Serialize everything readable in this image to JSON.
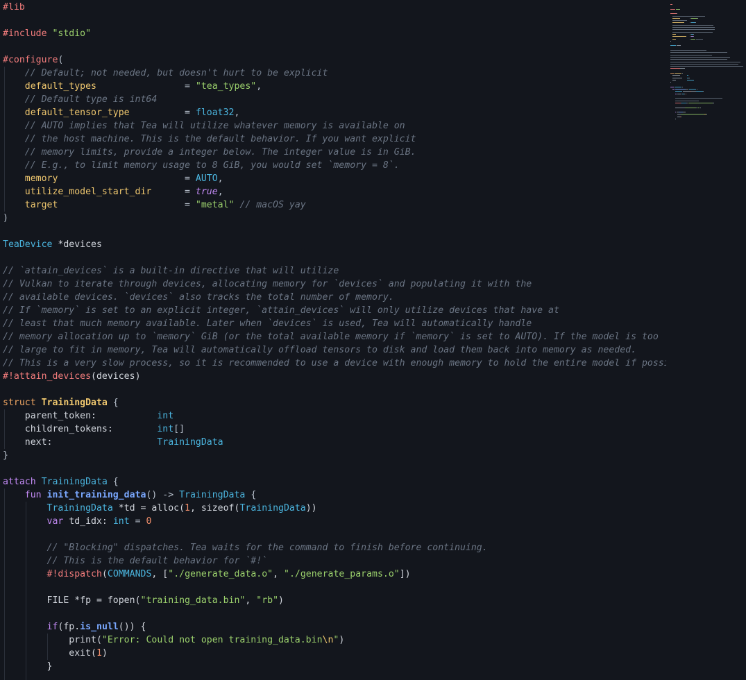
{
  "editor": {
    "language": "tea",
    "lines": [
      [
        [
          "#lib",
          "dir"
        ]
      ],
      [],
      [
        [
          "#include ",
          "dir"
        ],
        [
          "\"stdio\"",
          "str"
        ]
      ],
      [],
      [
        [
          "#configure",
          "dir"
        ],
        [
          "(",
          "op"
        ]
      ],
      [
        [
          "    // Default; not needed, but doesn't hurt to be explicit",
          "cmt"
        ]
      ],
      [
        [
          "    ",
          "plain"
        ],
        [
          "default_types",
          "key"
        ],
        [
          "                = ",
          "op"
        ],
        [
          "\"tea_types\"",
          "str"
        ],
        [
          ",",
          "op"
        ]
      ],
      [
        [
          "    // Default type is int64",
          "cmt"
        ]
      ],
      [
        [
          "    ",
          "plain"
        ],
        [
          "default_tensor_type",
          "key"
        ],
        [
          "          = ",
          "op"
        ],
        [
          "float32",
          "type"
        ],
        [
          ",",
          "op"
        ]
      ],
      [
        [
          "    // AUTO implies that Tea will utilize whatever memory is available on",
          "cmt"
        ]
      ],
      [
        [
          "    // the host machine. This is the default behavior. If you want explicit",
          "cmt"
        ]
      ],
      [
        [
          "    // memory limits, provide a integer below. The integer value is in GiB.",
          "cmt"
        ]
      ],
      [
        [
          "    // E.g., to limit memory usage to 8 GiB, you would set `memory = 8`.",
          "cmt"
        ]
      ],
      [
        [
          "    ",
          "plain"
        ],
        [
          "memory",
          "key"
        ],
        [
          "                       = ",
          "op"
        ],
        [
          "AUTO",
          "type"
        ],
        [
          ",",
          "op"
        ]
      ],
      [
        [
          "    ",
          "plain"
        ],
        [
          "utilize_model_start_dir",
          "key"
        ],
        [
          "      = ",
          "op"
        ],
        [
          "true",
          "bool"
        ],
        [
          ",",
          "op"
        ]
      ],
      [
        [
          "    ",
          "plain"
        ],
        [
          "target",
          "key"
        ],
        [
          "                       = ",
          "op"
        ],
        [
          "\"metal\"",
          "str"
        ],
        [
          " // macOS yay",
          "cmt"
        ]
      ],
      [
        [
          ")",
          "op"
        ]
      ],
      [],
      [
        [
          "TeaDevice",
          "type"
        ],
        [
          " *devices",
          "plain"
        ]
      ],
      [],
      [
        [
          "// `attain_devices` is a built-in directive that will utilize",
          "cmt"
        ]
      ],
      [
        [
          "// Vulkan to iterate through devices, allocating memory for `devices` and populating it with the",
          "cmt"
        ]
      ],
      [
        [
          "// available devices. `devices` also tracks the total number of memory.",
          "cmt"
        ]
      ],
      [
        [
          "// If `memory` is set to an explicit integer, `attain_devices` will only utilize devices that have at",
          "cmt"
        ]
      ],
      [
        [
          "// least that much memory available. Later when `devices` is used, Tea will automatically handle",
          "cmt"
        ]
      ],
      [
        [
          "// memory allocation up to `memory` GiB (or the total available memory if `memory` is set to AUTO). If the model is too",
          "cmt"
        ]
      ],
      [
        [
          "// large to fit in memory, Tea will automatically offload tensors to disk and load them back into memory as needed.",
          "cmt"
        ]
      ],
      [
        [
          "// This is a very slow process, so it is recommended to use a device with enough memory to hold the entire model if possible",
          "cmt"
        ]
      ],
      [
        [
          "#!attain_devices",
          "dir"
        ],
        [
          "(devices)",
          "plain"
        ]
      ],
      [],
      [
        [
          "struct ",
          "struct"
        ],
        [
          "TrainingData",
          "bold"
        ],
        [
          " {",
          "op"
        ]
      ],
      [
        [
          "    parent_token:           ",
          "plain"
        ],
        [
          "int",
          "type"
        ]
      ],
      [
        [
          "    children_tokens:        ",
          "plain"
        ],
        [
          "int",
          "type"
        ],
        [
          "[]",
          "op"
        ]
      ],
      [
        [
          "    next:                   ",
          "plain"
        ],
        [
          "TrainingData",
          "type"
        ]
      ],
      [
        [
          "}",
          "op"
        ]
      ],
      [],
      [
        [
          "attach ",
          "kw"
        ],
        [
          "TrainingData",
          "type"
        ],
        [
          " {",
          "op"
        ]
      ],
      [
        [
          "    ",
          "plain"
        ],
        [
          "fun ",
          "kw"
        ],
        [
          "init_training_data",
          "fnb"
        ],
        [
          "() -> ",
          "op"
        ],
        [
          "TrainingData",
          "type"
        ],
        [
          " {",
          "op"
        ]
      ],
      [
        [
          "        ",
          "plain"
        ],
        [
          "TrainingData",
          "type"
        ],
        [
          " *td = alloc(",
          "plain"
        ],
        [
          "1",
          "num"
        ],
        [
          ", sizeof(",
          "plain"
        ],
        [
          "TrainingData",
          "type"
        ],
        [
          "))",
          "plain"
        ]
      ],
      [
        [
          "        ",
          "plain"
        ],
        [
          "var ",
          "kw"
        ],
        [
          "td_idx: ",
          "plain"
        ],
        [
          "int",
          "type"
        ],
        [
          " = ",
          "op"
        ],
        [
          "0",
          "num"
        ]
      ],
      [],
      [
        [
          "        // \"Blocking\" dispatches. Tea waits for the command to finish before continuing.",
          "cmt"
        ]
      ],
      [
        [
          "        // This is the default behavior for `#!`",
          "cmt"
        ]
      ],
      [
        [
          "        ",
          "plain"
        ],
        [
          "#!dispatch",
          "dir"
        ],
        [
          "(",
          "plain"
        ],
        [
          "COMMANDS",
          "type"
        ],
        [
          ", [",
          "plain"
        ],
        [
          "\"./generate_data.o\"",
          "str"
        ],
        [
          ", ",
          "plain"
        ],
        [
          "\"./generate_params.o\"",
          "str"
        ],
        [
          "])",
          "plain"
        ]
      ],
      [],
      [
        [
          "        FILE *fp = fopen(",
          "plain"
        ],
        [
          "\"training_data.bin\"",
          "str"
        ],
        [
          ", ",
          "plain"
        ],
        [
          "\"rb\"",
          "str"
        ],
        [
          ")",
          "plain"
        ]
      ],
      [],
      [
        [
          "        ",
          "plain"
        ],
        [
          "if",
          "kw"
        ],
        [
          "(fp.",
          "plain"
        ],
        [
          "is_null",
          "fnb"
        ],
        [
          "()) {",
          "plain"
        ]
      ],
      [
        [
          "            print(",
          "plain"
        ],
        [
          "\"Error: Could not open training_data.bin",
          "str"
        ],
        [
          "\\n",
          "esc"
        ],
        [
          "\"",
          "str"
        ],
        [
          ")",
          "plain"
        ]
      ],
      [
        [
          "            exit(",
          "plain"
        ],
        [
          "1",
          "num"
        ],
        [
          ")",
          "plain"
        ]
      ],
      [
        [
          "        }",
          "plain"
        ]
      ],
      []
    ]
  },
  "colors": {
    "background": "#13161d",
    "directive": "#f47d7d",
    "string": "#9bd06c",
    "comment": "#6b7584",
    "config_key": "#f0c86f",
    "type": "#4bb5df",
    "keyword": "#c28af4",
    "struct_keyword": "#f0a663",
    "number": "#f08e6b",
    "function": "#7aa8ff",
    "text": "#d2d6dd"
  }
}
